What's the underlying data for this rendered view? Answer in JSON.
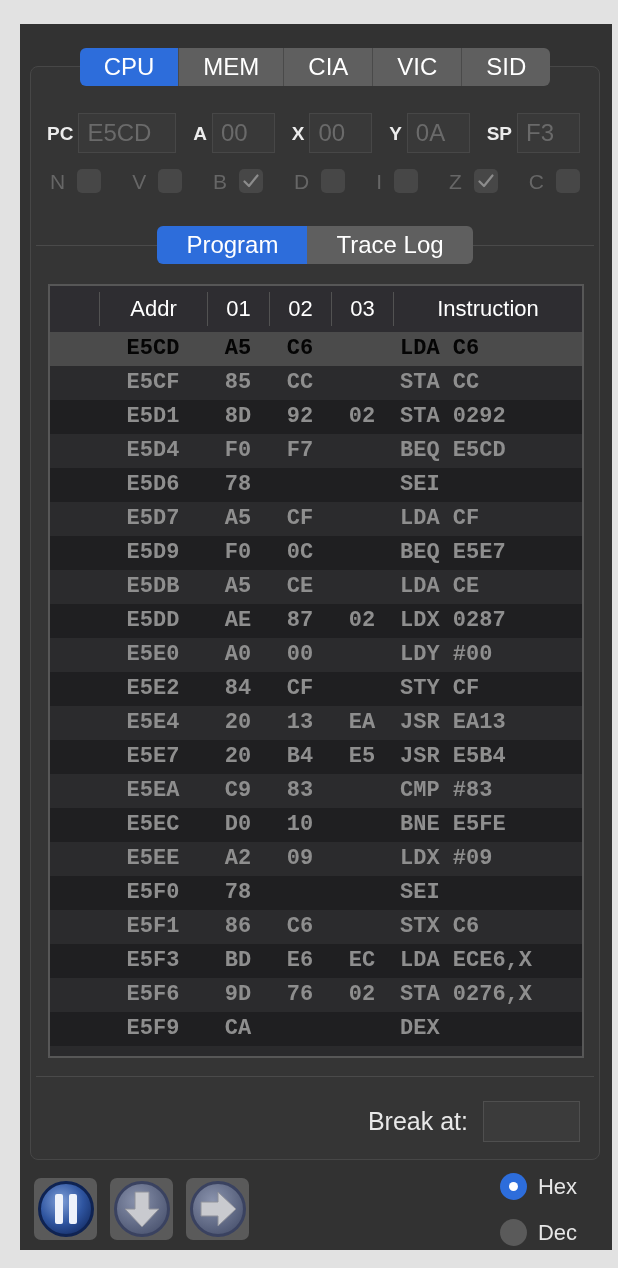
{
  "tabs": [
    {
      "label": "CPU",
      "selected": true
    },
    {
      "label": "MEM",
      "selected": false
    },
    {
      "label": "CIA",
      "selected": false
    },
    {
      "label": "VIC",
      "selected": false
    },
    {
      "label": "SID",
      "selected": false
    }
  ],
  "registers": [
    {
      "label": "PC",
      "value": "E5CD",
      "disabled": true
    },
    {
      "label": "A",
      "value": "00",
      "disabled": true
    },
    {
      "label": "X",
      "value": "00",
      "disabled": true
    },
    {
      "label": "Y",
      "value": "0A",
      "disabled": true
    },
    {
      "label": "SP",
      "value": "F3",
      "disabled": true
    }
  ],
  "flags": [
    {
      "label": "N",
      "checked": false,
      "disabled": true
    },
    {
      "label": "V",
      "checked": false,
      "disabled": true
    },
    {
      "label": "B",
      "checked": true,
      "disabled": true
    },
    {
      "label": "D",
      "checked": false,
      "disabled": true
    },
    {
      "label": "I",
      "checked": false,
      "disabled": true
    },
    {
      "label": "Z",
      "checked": true,
      "disabled": true
    },
    {
      "label": "C",
      "checked": false,
      "disabled": true
    }
  ],
  "view_tabs": [
    {
      "label": "Program",
      "selected": true
    },
    {
      "label": "Trace Log",
      "selected": false
    }
  ],
  "table": {
    "columns": [
      "Addr",
      "01",
      "02",
      "03",
      "Instruction"
    ],
    "rows": [
      {
        "addr": "E5CD",
        "byte_1": "A5",
        "byte_2": "C6",
        "instruction": "LDA C6",
        "selected": true
      },
      {
        "addr": "E5CF",
        "byte_1": "85",
        "byte_2": "CC",
        "instruction": "STA CC",
        "selected": false
      },
      {
        "addr": "E5D1",
        "byte_1": "8D",
        "byte_2": "92",
        "byte_3": "02",
        "instruction": "STA 0292",
        "selected": false
      },
      {
        "addr": "E5D4",
        "byte_1": "F0",
        "byte_2": "F7",
        "instruction": "BEQ E5CD",
        "selected": false
      },
      {
        "addr": "E5D6",
        "byte_1": "78",
        "instruction": "SEI",
        "selected": false
      },
      {
        "addr": "E5D7",
        "byte_1": "A5",
        "byte_2": "CF",
        "instruction": "LDA CF",
        "selected": false
      },
      {
        "addr": "E5D9",
        "byte_1": "F0",
        "byte_2": "0C",
        "instruction": "BEQ E5E7",
        "selected": false
      },
      {
        "addr": "E5DB",
        "byte_1": "A5",
        "byte_2": "CE",
        "instruction": "LDA CE",
        "selected": false
      },
      {
        "addr": "E5DD",
        "byte_1": "AE",
        "byte_2": "87",
        "byte_3": "02",
        "instruction": "LDX 0287",
        "selected": false
      },
      {
        "addr": "E5E0",
        "byte_1": "A0",
        "byte_2": "00",
        "instruction": "LDY #00",
        "selected": false
      },
      {
        "addr": "E5E2",
        "byte_1": "84",
        "byte_2": "CF",
        "instruction": "STY CF",
        "selected": false
      },
      {
        "addr": "E5E4",
        "byte_1": "20",
        "byte_2": "13",
        "byte_3": "EA",
        "instruction": "JSR EA13",
        "selected": false
      },
      {
        "addr": "E5E7",
        "byte_1": "20",
        "byte_2": "B4",
        "byte_3": "E5",
        "instruction": "JSR E5B4",
        "selected": false
      },
      {
        "addr": "E5EA",
        "byte_1": "C9",
        "byte_2": "83",
        "instruction": "CMP #83",
        "selected": false
      },
      {
        "addr": "E5EC",
        "byte_1": "D0",
        "byte_2": "10",
        "instruction": "BNE E5FE",
        "selected": false
      },
      {
        "addr": "E5EE",
        "byte_1": "A2",
        "byte_2": "09",
        "instruction": "LDX #09",
        "selected": false
      },
      {
        "addr": "E5F0",
        "byte_1": "78",
        "instruction": "SEI",
        "selected": false
      },
      {
        "addr": "E5F1",
        "byte_1": "86",
        "byte_2": "C6",
        "instruction": "STX C6",
        "selected": false
      },
      {
        "addr": "E5F3",
        "byte_1": "BD",
        "byte_2": "E6",
        "byte_3": "EC",
        "instruction": "LDA ECE6,X",
        "selected": false
      },
      {
        "addr": "E5F6",
        "byte_1": "9D",
        "byte_2": "76",
        "byte_3": "02",
        "instruction": "STA 0276,X",
        "selected": false
      },
      {
        "addr": "E5F9",
        "byte_1": "CA",
        "instruction": "DEX",
        "selected": false
      }
    ]
  },
  "break_at": {
    "label": "Break at:"
  },
  "radix": [
    {
      "label": "Hex",
      "selected": true
    },
    {
      "label": "Dec",
      "selected": false
    }
  ]
}
